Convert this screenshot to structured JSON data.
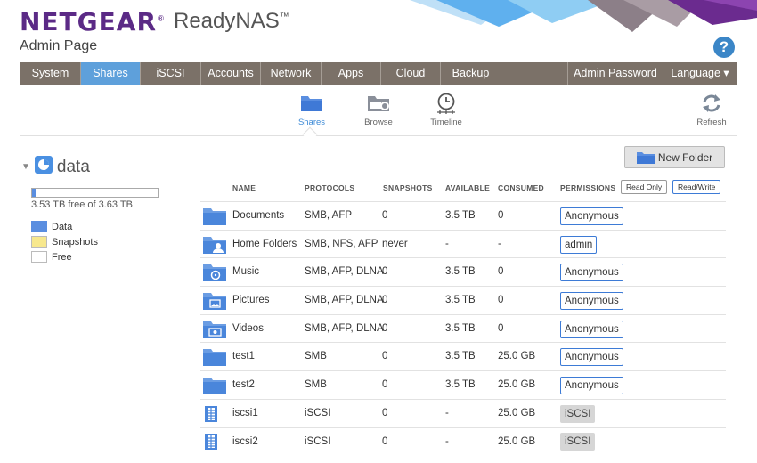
{
  "header": {
    "brand": "NETGEAR",
    "brand_mark": "®",
    "product": "ReadyNAS",
    "product_mark": "™",
    "page_title": "Admin Page",
    "help_label": "?"
  },
  "nav": {
    "items": [
      "System",
      "Shares",
      "iSCSI",
      "Accounts",
      "Network",
      "Apps",
      "Cloud",
      "Backup"
    ],
    "active": "Shares",
    "admin_password": "Admin Password",
    "language": "Language ▾"
  },
  "subnav": {
    "shares": "Shares",
    "browse": "Browse",
    "timeline": "Timeline",
    "refresh": "Refresh"
  },
  "volume": {
    "name": "data",
    "free_text": "3.53 TB free of 3.63 TB",
    "used_fraction": 0.027,
    "legend": [
      "Data",
      "Snapshots",
      "Free"
    ],
    "colors": {
      "data": "#5a8ee0",
      "snapshots": "#f7e88e",
      "free": "#ffffff"
    }
  },
  "toolbar": {
    "new_folder": "New Folder"
  },
  "table": {
    "headers": {
      "name": "NAME",
      "protocols": "PROTOCOLS",
      "snapshots": "SNAPSHOTS",
      "available": "AVAILABLE",
      "consumed": "CONSUMED",
      "permissions": "PERMISSIONS"
    },
    "read_only": "Read Only",
    "read_write": "Read/Write",
    "rows": [
      {
        "icon": "folder-icon",
        "name": "Documents",
        "protocols": "SMB, AFP",
        "snapshots": "0",
        "available": "3.5 TB",
        "consumed": "0",
        "permission": "Anonymous"
      },
      {
        "icon": "home-folder-icon",
        "name": "Home Folders",
        "protocols": "SMB, NFS, AFP",
        "snapshots": "never",
        "available": "-",
        "consumed": "-",
        "permission": "admin"
      },
      {
        "icon": "music-folder-icon",
        "name": "Music",
        "protocols": "SMB, AFP, DLNA",
        "snapshots": "0",
        "available": "3.5 TB",
        "consumed": "0",
        "permission": "Anonymous"
      },
      {
        "icon": "pictures-folder-icon",
        "name": "Pictures",
        "protocols": "SMB, AFP, DLNA",
        "snapshots": "0",
        "available": "3.5 TB",
        "consumed": "0",
        "permission": "Anonymous"
      },
      {
        "icon": "videos-folder-icon",
        "name": "Videos",
        "protocols": "SMB, AFP, DLNA",
        "snapshots": "0",
        "available": "3.5 TB",
        "consumed": "0",
        "permission": "Anonymous"
      },
      {
        "icon": "folder-icon",
        "name": "test1",
        "protocols": "SMB",
        "snapshots": "0",
        "available": "3.5 TB",
        "consumed": "25.0 GB",
        "permission": "Anonymous"
      },
      {
        "icon": "folder-icon",
        "name": "test2",
        "protocols": "SMB",
        "snapshots": "0",
        "available": "3.5 TB",
        "consumed": "25.0 GB",
        "permission": "Anonymous"
      },
      {
        "icon": "lun-icon",
        "name": "iscsi1",
        "protocols": "iSCSI",
        "snapshots": "0",
        "available": "-",
        "consumed": "25.0 GB",
        "permission": "iSCSI"
      },
      {
        "icon": "lun-icon",
        "name": "iscsi2",
        "protocols": "iSCSI",
        "snapshots": "0",
        "available": "-",
        "consumed": "25.0 GB",
        "permission": "iSCSI"
      }
    ]
  }
}
